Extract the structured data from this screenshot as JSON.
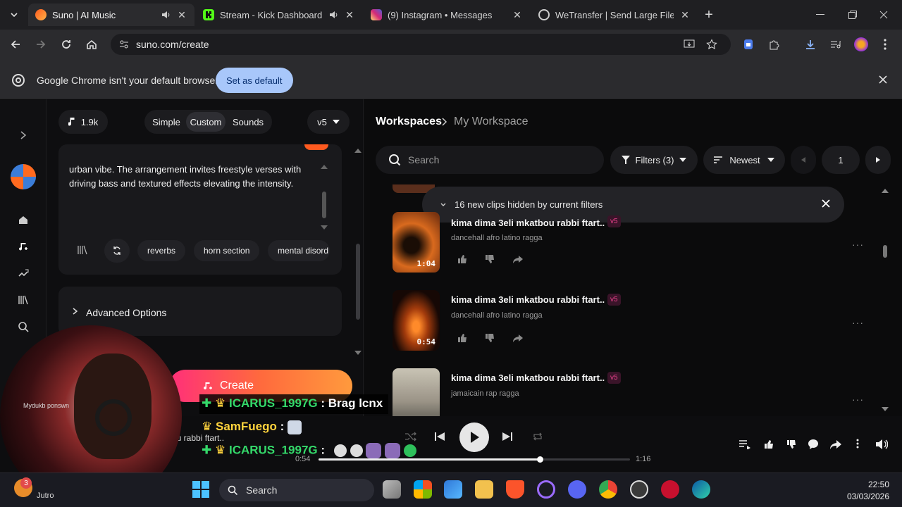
{
  "browser": {
    "tabs": [
      {
        "title": "Suno | AI Music",
        "active": true,
        "audio": true
      },
      {
        "title": "Stream - Kick Dashboard",
        "active": false,
        "audio": true
      },
      {
        "title": "(9) Instagram • Messages",
        "active": false,
        "audio": false
      },
      {
        "title": "WeTransfer | Send Large Files Fa",
        "active": false,
        "audio": false
      }
    ],
    "url": "suno.com/create",
    "infobar": {
      "message": "Google Chrome isn't your default browser",
      "button": "Set as default"
    }
  },
  "create_panel": {
    "credits": "1.9k",
    "modes": [
      "Simple",
      "Custom",
      "Sounds"
    ],
    "active_mode": "Custom",
    "model": "v5",
    "style_text": "urban vibe. The arrangement invites freestyle verses with driving bass and textured effects elevating the intensity.",
    "tags": [
      "reverbs",
      "horn section",
      "mental disord"
    ],
    "advanced_label": "Advanced Options",
    "create_button": "Create"
  },
  "workspace": {
    "breadcrumb_root": "Workspaces",
    "breadcrumb_current": "My Workspace",
    "search_placeholder": "Search",
    "filters_label": "Filters (3)",
    "sort_label": "Newest",
    "page": "1",
    "notice": "16 new clips hidden by current filters",
    "clips": [
      {
        "title": "kima dima 3eli mkatbou rabbi ftart..",
        "version": "v5",
        "style": "dancehall afro latino ragga",
        "duration": "1:04"
      },
      {
        "title": "kima dima 3eli mkatbou rabbi ftart..",
        "version": "v5",
        "style": "dancehall afro latino ragga",
        "duration": "0:54"
      },
      {
        "title": "kima dima 3eli mkatbou rabbi ftart..",
        "version": "v5",
        "style": "jamaicain rap ragga",
        "duration": ""
      }
    ]
  },
  "player": {
    "track_title": "ou rabbi ftart..",
    "elapsed": "0:54",
    "total": "1:16",
    "progress": 0.71
  },
  "overlay": {
    "chat": [
      {
        "user": "ICARUS_1997G",
        "message": ": Brag lcnx"
      },
      {
        "user": "SamFuego",
        "message": ":"
      },
      {
        "user": "ICARUS_1997G",
        "message": ":"
      }
    ],
    "webcam_caption": "Mydukb ponswn",
    "webcam_label": "Jutro"
  },
  "taskbar": {
    "search_label": "Search",
    "time": "22:50",
    "date": "03/03/2026",
    "notification_count": "3"
  },
  "colors": {
    "accent_blue": "#a8c7fa",
    "suno_orange": "#ff5a1f",
    "version_pink": "#e9418c",
    "chat_green": "#34d96a",
    "chat_yellow": "#ffd33d"
  }
}
